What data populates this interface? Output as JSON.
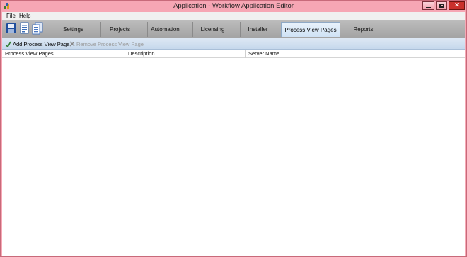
{
  "window": {
    "title": "Application - Workflow Application Editor"
  },
  "menu": {
    "items": [
      "File",
      "Help"
    ]
  },
  "toolbar": {
    "icons": [
      "save-icon",
      "document-list-icon",
      "documents-icon"
    ]
  },
  "tabs": {
    "items": [
      "Settings",
      "Projects",
      "Automation",
      "Licensing",
      "Installer",
      "Process View Pages",
      "Reports"
    ],
    "active": "Process View Pages"
  },
  "toolstrip": {
    "add_label": "Add Process View Page",
    "remove_label": "Remove Process View Page"
  },
  "table": {
    "columns": [
      "Process View Pages",
      "Description",
      "Server Name"
    ],
    "rows": []
  },
  "colors": {
    "titlebar": "#f6a6b4",
    "ribbon": "#a4a4a4",
    "active_tab": "#cfe2f5",
    "toolstrip": "#c6d8ec",
    "close_button": "#c9302c"
  }
}
